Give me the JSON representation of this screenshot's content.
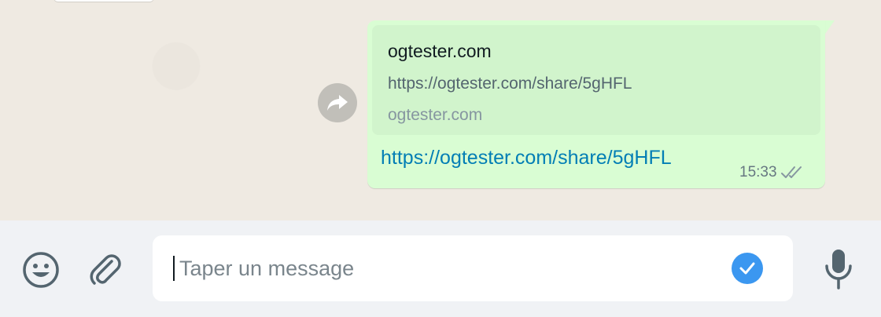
{
  "conversation": {
    "message": {
      "preview": {
        "title": "ogtester.com",
        "description": "https://ogtester.com/share/5gHFL",
        "domain": "ogtester.com"
      },
      "link_text": "https://ogtester.com/share/5gHFL",
      "time": "15:33",
      "status": "delivered",
      "bubble_color": "#d9fdd3"
    }
  },
  "composer": {
    "placeholder": "Taper un message",
    "value": "",
    "icons": {
      "left": [
        "emoji-icon",
        "paperclip-icon"
      ],
      "input_badge": "check-circle-icon",
      "right": "microphone-icon"
    }
  },
  "colors": {
    "chat_background": "#efeae2",
    "link": "#027eb5",
    "footer_background": "#f0f2f5",
    "badge": "#3b97f0"
  }
}
